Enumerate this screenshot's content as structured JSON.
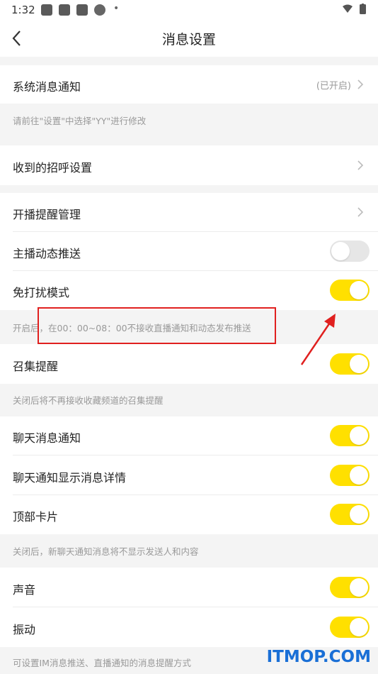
{
  "status_bar": {
    "time": "1:32",
    "dot": "•"
  },
  "header": {
    "title": "消息设置"
  },
  "rows": {
    "system_notify": {
      "label": "系统消息通知",
      "value": "(已开启)"
    },
    "greeting": {
      "label": "收到的招呼设置"
    },
    "live_remind": {
      "label": "开播提醒管理"
    },
    "anchor_push": {
      "label": "主播动态推送",
      "toggle": "off"
    },
    "dnd": {
      "label": "免打扰模式",
      "toggle": "on"
    },
    "gather": {
      "label": "召集提醒",
      "toggle": "on"
    },
    "chat_notify": {
      "label": "聊天消息通知",
      "toggle": "on"
    },
    "chat_detail": {
      "label": "聊天通知显示消息详情",
      "toggle": "on"
    },
    "top_card": {
      "label": "顶部卡片",
      "toggle": "on"
    },
    "sound": {
      "label": "声音",
      "toggle": "on"
    },
    "vibrate": {
      "label": "振动",
      "toggle": "on"
    }
  },
  "notes": {
    "system": "请前往\"设置\"中选择\"YY\"进行修改",
    "dnd": "开启后，在00：00~08：00不接收直播通知和动态发布推送",
    "gather": "关闭后将不再接收收藏频道的召集提醒",
    "chat": "关闭后，新聊天通知消息将不显示发送人和内容",
    "sound": "可设置IM消息推送、直播通知的消息提醒方式"
  },
  "watermark": "ITMOP.COM",
  "colors": {
    "toggle_on": "#ffe000",
    "toggle_off": "#e6e6e6",
    "annotation": "#e0201f",
    "watermark": "#1a6fd6"
  }
}
